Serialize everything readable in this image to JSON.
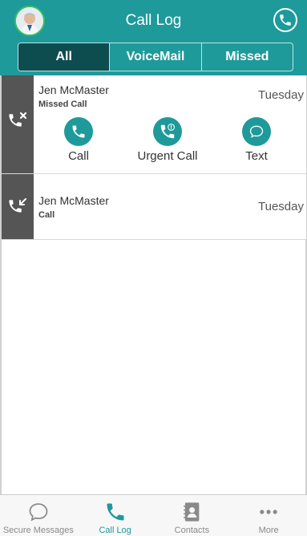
{
  "header": {
    "title": "Call Log",
    "avatar_icon": "doctor-avatar",
    "call_icon": "phone-icon",
    "accent": "#1e9a9b"
  },
  "segments": [
    {
      "label": "All",
      "active": true
    },
    {
      "label": "VoiceMail",
      "active": false
    },
    {
      "label": "Missed",
      "active": false
    }
  ],
  "calls": [
    {
      "name": "Jen McMaster",
      "type": "Missed Call",
      "when": "Tuesday",
      "icon": "missed-call-icon",
      "actions": [
        {
          "label": "Call",
          "icon": "phone-icon"
        },
        {
          "label": "Urgent Call",
          "icon": "urgent-phone-icon"
        },
        {
          "label": "Text",
          "icon": "chat-bubble-icon"
        }
      ]
    },
    {
      "name": "Jen McMaster",
      "type": "Call",
      "when": "Tuesday",
      "icon": "incoming-call-icon"
    }
  ],
  "tabbar": [
    {
      "label": "Secure Messages",
      "icon": "chat-bubble-icon",
      "active": false
    },
    {
      "label": "Call Log",
      "icon": "phone-icon",
      "active": true
    },
    {
      "label": "Contacts",
      "icon": "address-book-icon",
      "active": false
    },
    {
      "label": "More",
      "icon": "more-dots-icon",
      "active": false
    }
  ]
}
